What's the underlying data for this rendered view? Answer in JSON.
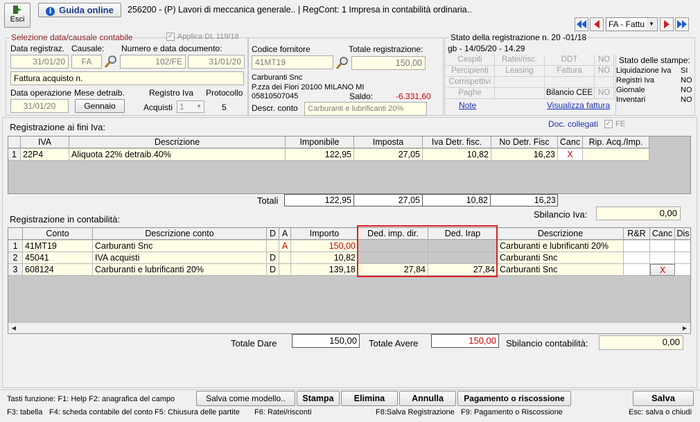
{
  "toolbar": {
    "exit_label": "Esci",
    "guide_label": "Guida online",
    "title": "256200 - (P) Lavori di meccanica generale.. | RegCont: 1 Impresa  in contabilità ordinaria.."
  },
  "nav": {
    "select_value": "FA - Fattu"
  },
  "selection": {
    "group_title": "Selezione data/causale contabile",
    "applica_label": "Applica DL 119/18",
    "date_label": "Data registraz.",
    "date_value": "31/01/20",
    "causale_label": "Causale:",
    "causale_value": "FA",
    "doc_label": "Numero e data documento:",
    "doc_number": "102/FE",
    "doc_date": "31/01/20",
    "description": "Fattura acquisto n.",
    "op_date_label": "Data operazione",
    "op_date_value": "31/01/20",
    "month_label": "Mese detraib.",
    "month_value": "Gennaio",
    "register_label": "Registro Iva",
    "register_type": "Acquisti",
    "register_value": "1",
    "protocol_label": "Protocollo",
    "protocol_value": "5"
  },
  "supplier": {
    "code_label": "Codice fornitore",
    "code_value": "41MT19",
    "total_label": "Totale registrazione:",
    "total_value": "150,00",
    "name": "Carburanti Snc",
    "address": "P.zza dei Fiori 20100 MILANO MI",
    "vat": "05810507045",
    "balance_label": "Saldo:",
    "balance_value": "-6.331,60",
    "account_label": "Descr. conto",
    "account_value": "Carburanti e lubrificanti 20%"
  },
  "status": {
    "title": "Stato della registrazione n. 20   -01/18",
    "subtitle": "gb - 14/05/20    - 14.29",
    "cells": [
      [
        "Cespiti",
        "Ratei/risc.",
        "DDT",
        "NO"
      ],
      [
        "Percipienti",
        "Leasing",
        "Fattura",
        "NO"
      ],
      [
        "Corrispettivi",
        "",
        "",
        ""
      ],
      [
        "Paghe",
        "",
        "Bilancio CEE",
        "NO"
      ]
    ],
    "note_link": "Note",
    "view_invoice_link": "Visualizza fattura",
    "print_title": "Stato delle stampe:",
    "prints": [
      {
        "label": "Liquidazione Iva",
        "value": "SI"
      },
      {
        "label": "Registri Iva",
        "value": "NO"
      },
      {
        "label": "Giornale",
        "value": "NO"
      },
      {
        "label": "Inventari",
        "value": "NO"
      }
    ]
  },
  "iva": {
    "title": "Registrazione ai fini Iva:",
    "linked_label": "Doc. collegati",
    "fe_label": "FE",
    "headers": [
      "",
      "IVA",
      "Descrizione",
      "Imponibile",
      "Imposta",
      "Iva Detr. fisc.",
      "No Detr. Fisc",
      "Canc",
      "Rip. Acq./Imp."
    ],
    "rows": [
      {
        "n": "1",
        "code": "22P4",
        "desc": "Aliquota 22% detraib.40%",
        "imponibile": "122,95",
        "imposta": "27,05",
        "detr": "10,82",
        "nodetr": "16,23",
        "canc": "X"
      }
    ],
    "totals_label": "Totali",
    "totals": {
      "imponibile": "122,95",
      "imposta": "27,05",
      "detr": "10,82",
      "nodetr": "16,23"
    },
    "imbalance_label": "Sbilancio Iva:",
    "imbalance_value": "0,00"
  },
  "accounting": {
    "title": "Registrazione in contabilità:",
    "headers": [
      "",
      "Conto",
      "Descrizione conto",
      "D",
      "A",
      "Importo",
      "Ded. imp. dir.",
      "Ded. Irap",
      "Descrizione",
      "R&R",
      "Canc",
      "Dis"
    ],
    "rows": [
      {
        "n": "1",
        "conto": "41MT19",
        "desc": "Carburanti Snc",
        "d": "",
        "a": "A",
        "importo": "150,00",
        "ded": "",
        "irap": "",
        "descr": "Carburanti e lubrificanti 20%",
        "canc": ""
      },
      {
        "n": "2",
        "conto": "45041",
        "desc": "IVA acquisti",
        "d": "D",
        "a": "",
        "importo": "10,82",
        "ded": "",
        "irap": "",
        "descr": "Carburanti Snc",
        "canc": ""
      },
      {
        "n": "3",
        "conto": "608124",
        "desc": "Carburanti e lubrificanti 20%",
        "d": "D",
        "a": "",
        "importo": "139,18",
        "ded": "27,84",
        "irap": "27,84",
        "descr": "Carburanti Snc",
        "canc": "X"
      }
    ],
    "dare_label": "Totale Dare",
    "dare_value": "150,00",
    "avere_label": "Totale Avere",
    "avere_value": "150,00",
    "imbalance_label": "Sbilancio contabilità:",
    "imbalance_value": "0,00"
  },
  "footer": {
    "keys_line1": "Tasti funzione: F1: Help  F2: anagrafica del campo",
    "f3": "F3: tabella",
    "f4": "F4: scheda contabile del conto",
    "f5": "F5: Chiusura delle partite",
    "f6": "F6: Ratei/risconti",
    "f8": "F8:Salva Registrazione",
    "f9": "F9: Pagamento o Riscossione",
    "esc": "Esc: salva o chiudi",
    "save_model": "Salva come modello..",
    "print": "Stampa",
    "delete": "Elimina",
    "cancel": "Annulla",
    "payment": "Pagamento o riscossione",
    "save": "Salva"
  },
  "colors": {
    "field_bg": "#fffde6",
    "grid_bg": "#c7c7c7",
    "red": "#d00000",
    "highlight": "#e02020",
    "link": "#1a30b0"
  }
}
